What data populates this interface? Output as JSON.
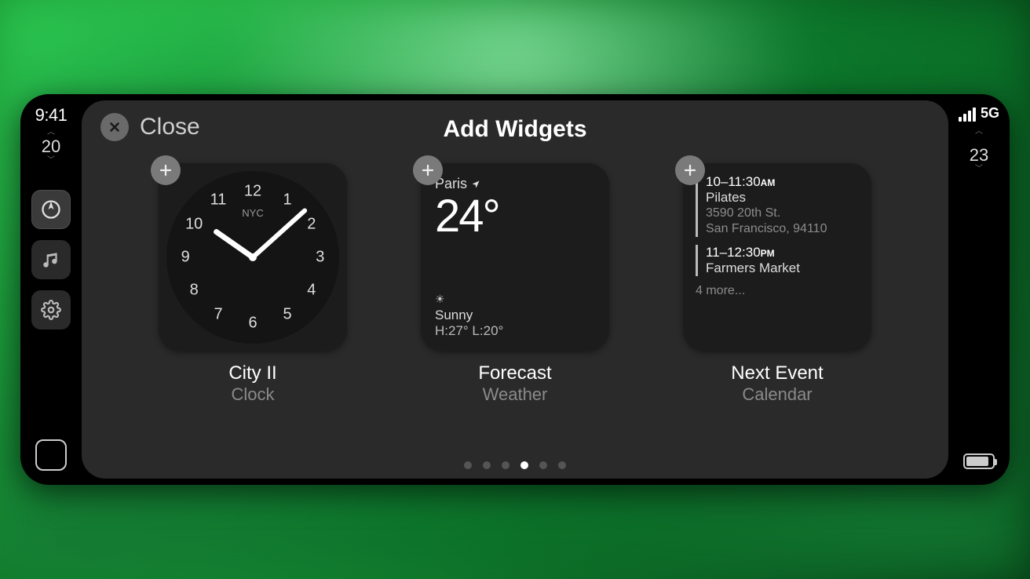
{
  "status": {
    "time": "9:41",
    "left_value": "20",
    "right_value": "23",
    "network_label": "5G"
  },
  "header": {
    "close_label": "Close",
    "title": "Add Widgets"
  },
  "widgets": [
    {
      "title": "City II",
      "subtitle": "Clock",
      "clock": {
        "city_label": "NYC"
      }
    },
    {
      "title": "Forecast",
      "subtitle": "Weather",
      "weather": {
        "location": "Paris",
        "temperature": "24°",
        "condition": "Sunny",
        "high_low": "H:27°  L:20°"
      }
    },
    {
      "title": "Next Event",
      "subtitle": "Calendar",
      "calendar": {
        "events": [
          {
            "time": "10–11:30",
            "ampm": "AM",
            "name": "Pilates",
            "address1": "3590 20th St.",
            "address2": "San Francisco, 94110"
          },
          {
            "time": "11–12:30",
            "ampm": "PM",
            "name": "Farmers Market"
          }
        ],
        "more_label": "4 more..."
      }
    }
  ],
  "pagination": {
    "count": 6,
    "active_index": 3
  },
  "icons": {
    "maps": "maps-icon",
    "music": "music-icon",
    "settings": "settings-icon"
  }
}
